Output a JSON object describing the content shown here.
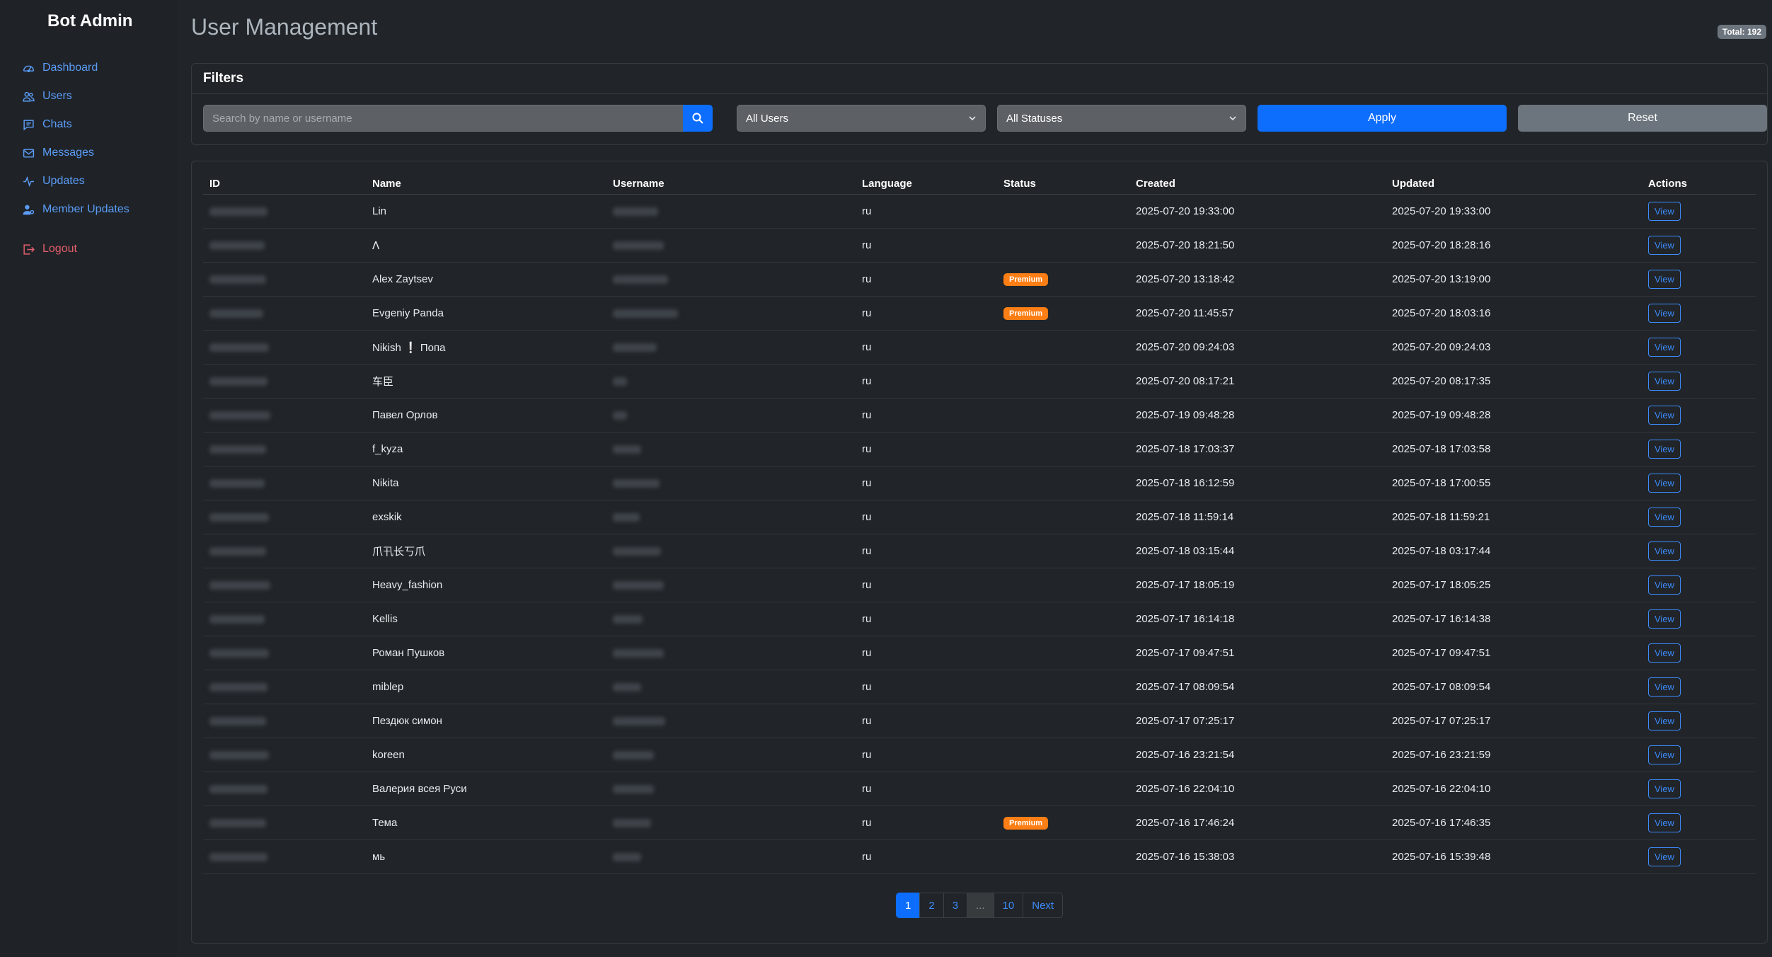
{
  "app": {
    "brand": "Bot Admin"
  },
  "sidebar": {
    "items": [
      {
        "label": "Dashboard",
        "icon": "gauge-icon"
      },
      {
        "label": "Users",
        "icon": "users-icon"
      },
      {
        "label": "Chats",
        "icon": "chat-icon"
      },
      {
        "label": "Messages",
        "icon": "envelope-icon"
      },
      {
        "label": "Updates",
        "icon": "activity-icon"
      },
      {
        "label": "Member Updates",
        "icon": "person-gear-icon"
      }
    ],
    "logout": {
      "label": "Logout",
      "icon": "logout-icon"
    }
  },
  "header": {
    "title": "User Management",
    "total_badge": "Total: 192"
  },
  "filters": {
    "title": "Filters",
    "search_placeholder": "Search by name or username",
    "search_value": "",
    "users_select": "All Users",
    "status_select": "All Statuses",
    "apply_label": "Apply",
    "reset_label": "Reset"
  },
  "table": {
    "columns": [
      "ID",
      "Name",
      "Username",
      "Language",
      "Status",
      "Created",
      "Updated",
      "Actions"
    ],
    "view_label": "View",
    "premium_label": "Premium",
    "rows": [
      {
        "name": "Lin",
        "language": "ru",
        "premium": false,
        "created": "2025-07-20 19:33:00",
        "updated": "2025-07-20 19:33:00"
      },
      {
        "name": "ⴷ",
        "language": "ru",
        "premium": false,
        "created": "2025-07-20 18:21:50",
        "updated": "2025-07-20 18:28:16"
      },
      {
        "name": "Alex Zaytsev",
        "language": "ru",
        "premium": true,
        "created": "2025-07-20 13:18:42",
        "updated": "2025-07-20 13:19:00"
      },
      {
        "name": "Evgeniy Panda",
        "language": "ru",
        "premium": true,
        "created": "2025-07-20 11:45:57",
        "updated": "2025-07-20 18:03:16"
      },
      {
        "name": "Nikish ❕ Попа",
        "language": "ru",
        "premium": false,
        "created": "2025-07-20 09:24:03",
        "updated": "2025-07-20 09:24:03"
      },
      {
        "name": "车臣",
        "language": "ru",
        "premium": false,
        "created": "2025-07-20 08:17:21",
        "updated": "2025-07-20 08:17:35"
      },
      {
        "name": "Павел Орлов",
        "language": "ru",
        "premium": false,
        "created": "2025-07-19 09:48:28",
        "updated": "2025-07-19 09:48:28"
      },
      {
        "name": "f_kyza",
        "language": "ru",
        "premium": false,
        "created": "2025-07-18 17:03:37",
        "updated": "2025-07-18 17:03:58"
      },
      {
        "name": "Nikita",
        "language": "ru",
        "premium": false,
        "created": "2025-07-18 16:12:59",
        "updated": "2025-07-18 17:00:55"
      },
      {
        "name": "exskik",
        "language": "ru",
        "premium": false,
        "created": "2025-07-18 11:59:14",
        "updated": "2025-07-18 11:59:21"
      },
      {
        "name": "爪卂长丂爪",
        "language": "ru",
        "premium": false,
        "created": "2025-07-18 03:15:44",
        "updated": "2025-07-18 03:17:44"
      },
      {
        "name": "Heavy_fashion",
        "language": "ru",
        "premium": false,
        "created": "2025-07-17 18:05:19",
        "updated": "2025-07-17 18:05:25"
      },
      {
        "name": "Kellis",
        "language": "ru",
        "premium": false,
        "created": "2025-07-17 16:14:18",
        "updated": "2025-07-17 16:14:38"
      },
      {
        "name": "Роман Пушков",
        "language": "ru",
        "premium": false,
        "created": "2025-07-17 09:47:51",
        "updated": "2025-07-17 09:47:51"
      },
      {
        "name": "miblep",
        "language": "ru",
        "premium": false,
        "created": "2025-07-17 08:09:54",
        "updated": "2025-07-17 08:09:54"
      },
      {
        "name": "Пездюк симон",
        "language": "ru",
        "premium": false,
        "created": "2025-07-17 07:25:17",
        "updated": "2025-07-17 07:25:17"
      },
      {
        "name": "koreen",
        "language": "ru",
        "premium": false,
        "created": "2025-07-16 23:21:54",
        "updated": "2025-07-16 23:21:59"
      },
      {
        "name": "Валерия всея Руси",
        "language": "ru",
        "premium": false,
        "created": "2025-07-16 22:04:10",
        "updated": "2025-07-16 22:04:10"
      },
      {
        "name": "Тема",
        "language": "ru",
        "premium": true,
        "created": "2025-07-16 17:46:24",
        "updated": "2025-07-16 17:46:35"
      },
      {
        "name": "мь",
        "language": "ru",
        "premium": false,
        "created": "2025-07-16 15:38:03",
        "updated": "2025-07-16 15:39:48"
      }
    ]
  },
  "pagination": {
    "pages": [
      {
        "label": "1",
        "state": "active"
      },
      {
        "label": "2",
        "state": "normal"
      },
      {
        "label": "3",
        "state": "normal"
      },
      {
        "label": "...",
        "state": "disabled"
      },
      {
        "label": "10",
        "state": "normal"
      },
      {
        "label": "Next",
        "state": "normal"
      }
    ]
  },
  "colors": {
    "background": "#212529",
    "sidebar": "#1f2328",
    "link": "#5b9cf6",
    "primary": "#0d6efd",
    "secondary": "#6c757d",
    "premium": "#fd7e14",
    "danger": "#e35d6a"
  }
}
